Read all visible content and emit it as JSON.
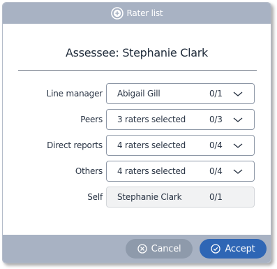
{
  "header": {
    "title": "Rater list"
  },
  "assessee": {
    "label": "Assessee: Stephanie Clark"
  },
  "rows": [
    {
      "label": "Line manager",
      "value": "Abigail Gill",
      "count": "0/1"
    },
    {
      "label": "Peers",
      "value": "3 raters selected",
      "count": "0/3"
    },
    {
      "label": "Direct reports",
      "value": "4 raters selected",
      "count": "0/4"
    },
    {
      "label": "Others",
      "value": "4 raters selected",
      "count": "0/4"
    },
    {
      "label": "Self",
      "value": "Stephanie Clark",
      "count": "0/1"
    }
  ],
  "footer": {
    "cancel_label": "Cancel",
    "accept_label": "Accept"
  },
  "colors": {
    "header": "#a8b2c3",
    "accent": "#2e66b5",
    "cancel": "#8e9aab"
  }
}
